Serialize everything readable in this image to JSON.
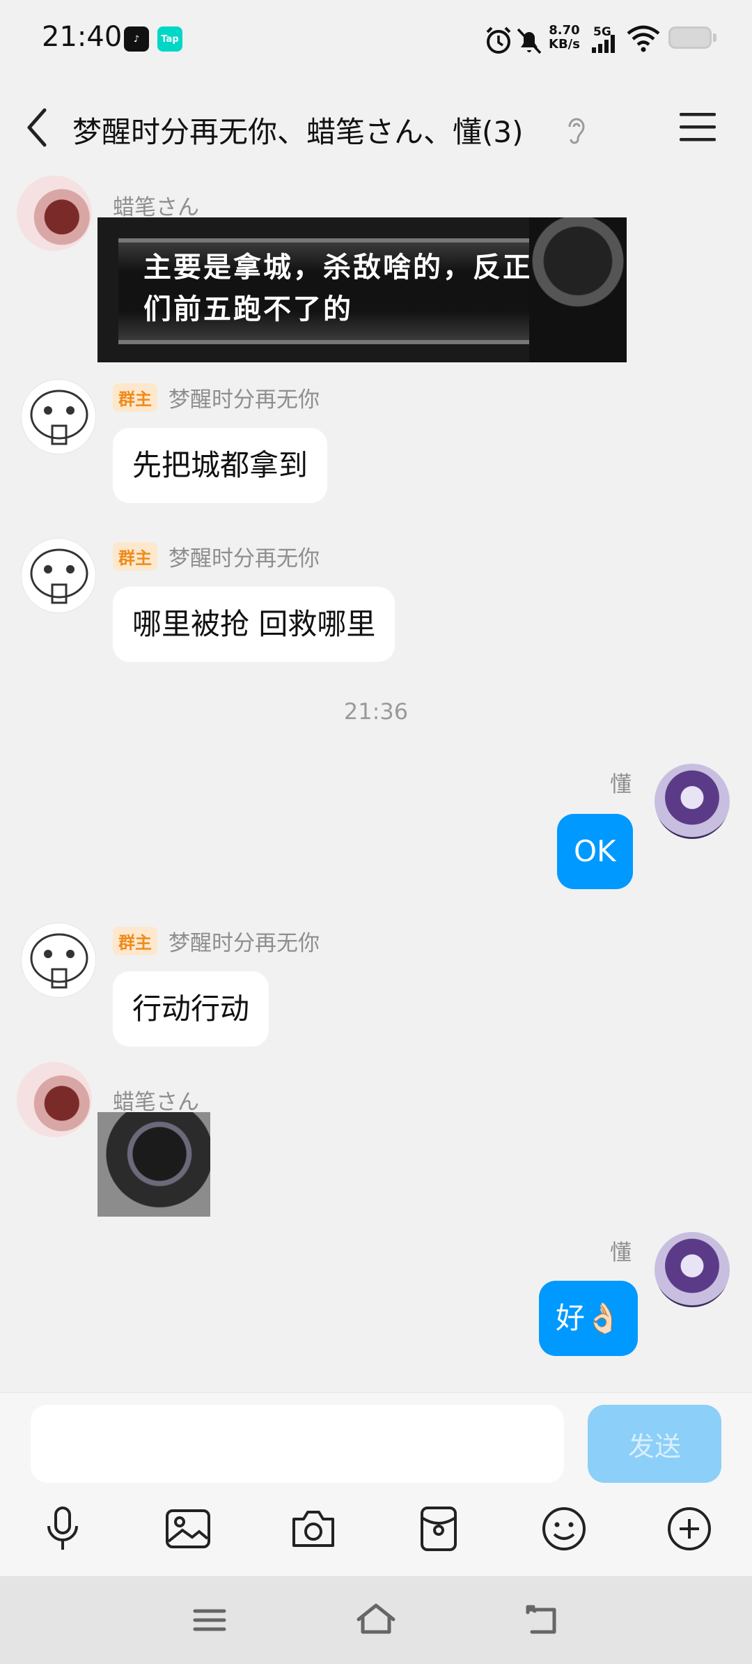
{
  "status_bar": {
    "time": "21:40",
    "app_icons": [
      "tiktok-icon",
      "tap-icon"
    ],
    "tap_label": "Tap",
    "network_speed_value": "8.70",
    "network_speed_unit": "KB/s",
    "network_type": "5G",
    "icons": [
      "alarm-icon",
      "mute-bell-icon",
      "signal-icon",
      "wifi-icon",
      "battery-icon"
    ]
  },
  "header": {
    "title": "梦醒时分再无你、蜡笔さん、懂(3)",
    "icons": [
      "back-icon",
      "ear-icon",
      "menu-icon"
    ]
  },
  "messages": [
    {
      "sender": "蜡笔さん",
      "type": "sticker",
      "sticker_text": "主要是拿城，杀敌啥的，反正咱们前五跑不了的"
    },
    {
      "sender": "梦醒时分再无你",
      "badge": "群主",
      "type": "text",
      "text": "先把城都拿到"
    },
    {
      "sender": "梦醒时分再无你",
      "badge": "群主",
      "type": "text",
      "text": "哪里被抢 回救哪里"
    },
    {
      "type": "timestamp",
      "text": "21:36"
    },
    {
      "sender": "懂",
      "type": "text",
      "text": "OK",
      "outgoing": true
    },
    {
      "sender": "梦醒时分再无你",
      "badge": "群主",
      "type": "text",
      "text": "行动行动"
    },
    {
      "sender": "蜡笔さん",
      "type": "sticker"
    },
    {
      "sender": "懂",
      "type": "text",
      "text": "好👌🏻",
      "outgoing": true
    }
  ],
  "input": {
    "value": "",
    "send_label": "发送",
    "tool_icons": [
      "microphone-icon",
      "image-icon",
      "camera-icon",
      "red-packet-icon",
      "emoji-icon",
      "plus-icon"
    ]
  },
  "nav_bar": {
    "icons": [
      "recents-icon",
      "home-icon",
      "back-nav-icon"
    ]
  },
  "colors": {
    "background": "#f1f1f1",
    "outgoing_bubble": "#0099ff",
    "incoming_bubble": "#ffffff",
    "send_button": "#8ccff8",
    "owner_badge_bg": "#fde8cd",
    "owner_badge_text": "#f08a1b"
  }
}
